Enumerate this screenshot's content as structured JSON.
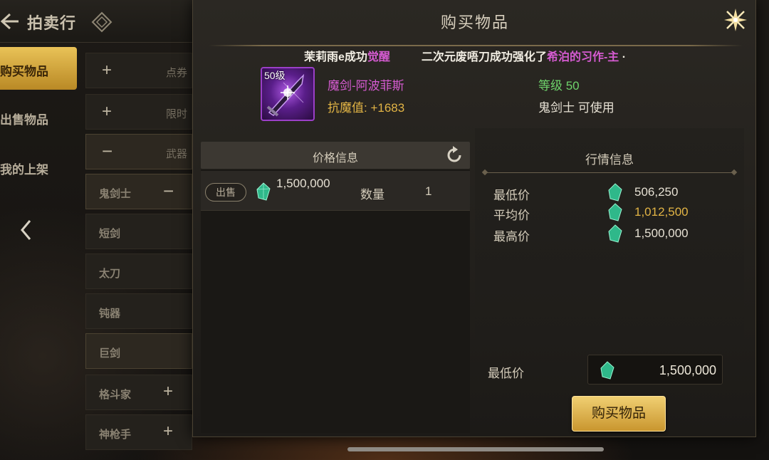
{
  "app": {
    "title": "拍卖行"
  },
  "sidebar": {
    "items": [
      {
        "label": "购买物品",
        "active": true
      },
      {
        "label": "出售物品",
        "active": false
      },
      {
        "label": "我的上架",
        "active": false
      }
    ]
  },
  "categories": [
    {
      "icon": "+",
      "label": "点券"
    },
    {
      "icon": "+",
      "label": "限时"
    },
    {
      "icon": "−",
      "label": "武器"
    },
    {
      "icon": "−",
      "label": "鬼剑士"
    },
    {
      "label": "短剑"
    },
    {
      "label": "太刀"
    },
    {
      "label": "钝器"
    },
    {
      "label": "巨剑"
    },
    {
      "icon": "+",
      "label": "格斗家"
    },
    {
      "icon": "+",
      "label": "神枪手"
    }
  ],
  "modal": {
    "title": "购买物品",
    "ticker": {
      "msg1_name": "茉莉雨e成功",
      "msg1_action": "觉醒",
      "msg2_prefix": "二次元废唔刀成功强化了",
      "msg2_item": "希泊的习作-主",
      "msg2_tail": "·"
    },
    "item": {
      "level_badge": "50级",
      "name": "魔剑-阿波菲斯",
      "stat": "抗魔值: +1683",
      "grade": "等级 50",
      "usable_by": "鬼剑士 可使用"
    },
    "price_info": {
      "header": "价格信息",
      "listings": [
        {
          "badge": "出售",
          "price": "1,500,000",
          "qty_label": "数量",
          "qty": "1"
        }
      ]
    },
    "market_info": {
      "header": "行情信息",
      "rows": [
        {
          "label": "最低价",
          "value": "506,250"
        },
        {
          "label": "平均价",
          "value": "1,012,500"
        },
        {
          "label": "最高价",
          "value": "1,500,000"
        }
      ]
    },
    "purchase": {
      "label": "最低价",
      "value": "1,500,000",
      "button": "购买物品"
    }
  },
  "colors": {
    "accent_gold": "#e2b445",
    "item_purple": "#d65bd2",
    "grade_green": "#6ed36b",
    "gem_teal": "#3fd0a0"
  },
  "icons": [
    "back-arrow-icon",
    "diamond-icon",
    "close-icon",
    "refresh-icon",
    "gem-icon",
    "left-arrow-icon",
    "sword-icon"
  ]
}
